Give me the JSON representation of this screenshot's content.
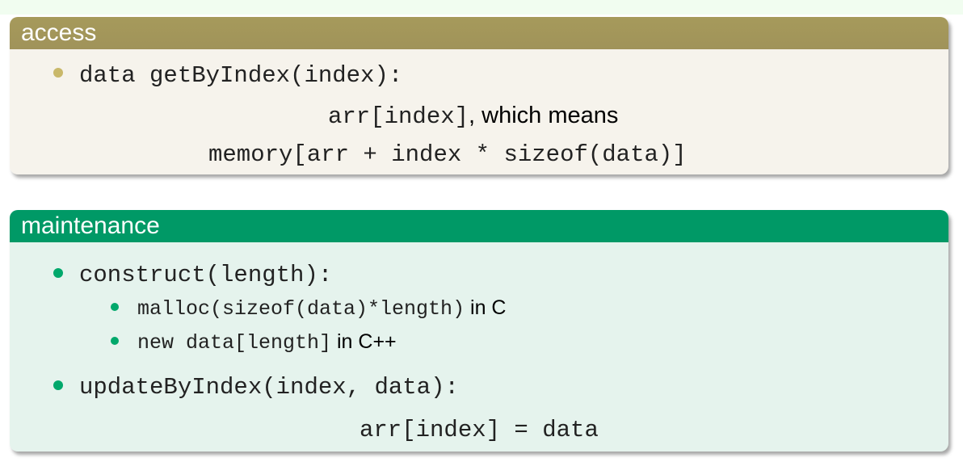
{
  "access": {
    "title": "access",
    "bullet1_code": "data getByIndex(index):",
    "line2_code": "arr[index]",
    "line2_text": ", which means",
    "line3_code": "memory[arr + index * sizeof(data)]"
  },
  "maintenance": {
    "title": "maintenance",
    "bullet1_code": "construct(length):",
    "sub1_code": "malloc(sizeof(data)*length)",
    "sub1_text": " in C",
    "sub2_code": "new data[length]",
    "sub2_text": " in C++",
    "bullet2_code": "updateByIndex(index, data):",
    "line_code": "arr[index] = data"
  },
  "colors": {
    "access_header": "#a69a5b",
    "access_body": "#f6f3ec",
    "maintenance_header": "#009966",
    "maintenance_body": "#e5f3ed",
    "top_band": "#f1fdf0"
  }
}
